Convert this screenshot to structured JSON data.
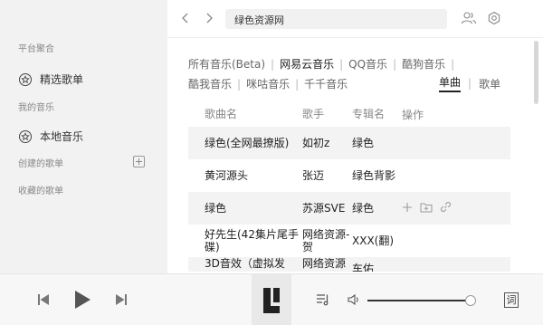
{
  "sidebar": {
    "section_platform": "平台聚合",
    "featured_playlists": "精选歌单",
    "section_my_music": "我的音乐",
    "local_music": "本地音乐",
    "created_playlists": "创建的歌单",
    "collected_playlists": "收藏的歌单"
  },
  "search": {
    "query": "绿色资源网"
  },
  "sources": {
    "items": [
      "所有音乐(Beta)",
      "网易云音乐",
      "QQ音乐",
      "酷狗音乐",
      "酷我音乐",
      "咪咕音乐",
      "千千音乐"
    ],
    "active": "网易云音乐"
  },
  "type_tabs": {
    "items": [
      "单曲",
      "歌单"
    ],
    "active": "单曲"
  },
  "table": {
    "headers": [
      "歌曲名",
      "歌手",
      "专辑名",
      "操作"
    ],
    "rows": [
      {
        "name": "绿色(全网最撩版)",
        "artist": "如初z",
        "album": "绿色"
      },
      {
        "name": "黄河源头",
        "artist": "张迈",
        "album": "绿色背影"
      },
      {
        "name": "绿色",
        "artist": "苏源SVE",
        "album": "绿色"
      },
      {
        "name": "好先生(42集片尾手碟)",
        "artist": "网络资源-贺",
        "album": "XXX(翻)"
      },
      {
        "name": "3D音效（虚拟发",
        "artist": "网络资源",
        "album": "车佑"
      }
    ]
  },
  "player": {
    "cover_letter": "L",
    "lyric_label": "词",
    "volume_fraction": 0.97
  },
  "colors": {
    "sidebar_bg": "#f2f2f2",
    "row_highlight": "#f3f3f3",
    "player_bg": "#f7f7f7"
  }
}
